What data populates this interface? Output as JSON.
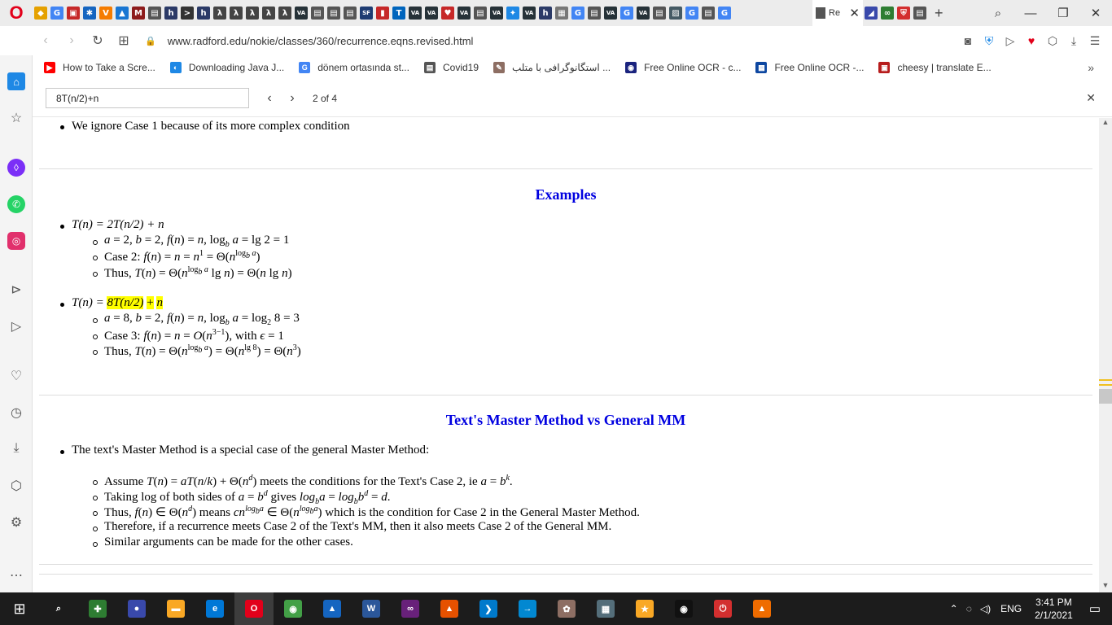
{
  "browser": {
    "active_tab_title": "Re",
    "url": "www.radford.edu/nokie/classes/360/recurrence.eqns.revised.html",
    "tab_icons": [
      {
        "icon": "opera-gx-icon",
        "color": "#e5a100",
        "label": "◆"
      },
      {
        "icon": "google-icon",
        "color": "#4285f4",
        "label": "G"
      },
      {
        "icon": "app-icon",
        "color": "#c62828",
        "label": "▣"
      },
      {
        "icon": "settings-icon",
        "color": "#1565c0",
        "label": "✱"
      },
      {
        "icon": "v-icon",
        "color": "#f57c00",
        "label": "V"
      },
      {
        "icon": "drive-icon",
        "color": "#1976d2",
        "label": "▲"
      },
      {
        "icon": "mit-icon",
        "color": "#8d1b1b",
        "label": "M"
      },
      {
        "icon": "document-icon",
        "color": "#555555",
        "label": "▤"
      },
      {
        "icon": "h-icon",
        "color": "#2b3a67",
        "label": "h"
      },
      {
        "icon": "terminal-icon",
        "color": "#333333",
        "label": ">"
      },
      {
        "icon": "h-icon",
        "color": "#2b3a67",
        "label": "h"
      },
      {
        "icon": "lambda-icon",
        "color": "#444444",
        "label": "λ"
      },
      {
        "icon": "lambda-icon",
        "color": "#444444",
        "label": "λ"
      },
      {
        "icon": "lambda-icon",
        "color": "#444444",
        "label": "λ"
      },
      {
        "icon": "lambda-icon",
        "color": "#444444",
        "label": "λ"
      },
      {
        "icon": "lambda-icon",
        "color": "#444444",
        "label": "λ"
      },
      {
        "icon": "va-icon",
        "color": "#263238",
        "label": "VA"
      },
      {
        "icon": "document-icon",
        "color": "#555555",
        "label": "▤"
      },
      {
        "icon": "document-icon",
        "color": "#555555",
        "label": "▤"
      },
      {
        "icon": "document-icon",
        "color": "#555555",
        "label": "▤"
      },
      {
        "icon": "sf-icon",
        "color": "#1e3c72",
        "label": "SF"
      },
      {
        "icon": "bar-chart-icon",
        "color": "#c62828",
        "label": "▮"
      },
      {
        "icon": "tum-icon",
        "color": "#0065bd",
        "label": "T"
      },
      {
        "icon": "va-icon",
        "color": "#263238",
        "label": "VA"
      },
      {
        "icon": "va-icon",
        "color": "#263238",
        "label": "VA"
      },
      {
        "icon": "heart-icon",
        "color": "#c62828",
        "label": "♥"
      },
      {
        "icon": "va-icon",
        "color": "#263238",
        "label": "VA"
      },
      {
        "icon": "document-icon",
        "color": "#555555",
        "label": "▤"
      },
      {
        "icon": "va-icon",
        "color": "#263238",
        "label": "VA"
      },
      {
        "icon": "star-icon",
        "color": "#1e88e5",
        "label": "✦"
      },
      {
        "icon": "va-icon",
        "color": "#263238",
        "label": "VA"
      },
      {
        "icon": "h-icon",
        "color": "#2b3a67",
        "label": "h"
      },
      {
        "icon": "grid-icon",
        "color": "#777777",
        "label": "▦"
      },
      {
        "icon": "google-icon",
        "color": "#4285f4",
        "label": "G"
      },
      {
        "icon": "document-icon",
        "color": "#555555",
        "label": "▤"
      },
      {
        "icon": "va-icon",
        "color": "#263238",
        "label": "VA"
      },
      {
        "icon": "google-icon",
        "color": "#4285f4",
        "label": "G"
      },
      {
        "icon": "va-icon",
        "color": "#263238",
        "label": "VA"
      },
      {
        "icon": "document-icon",
        "color": "#555555",
        "label": "▤"
      },
      {
        "icon": "image-icon",
        "color": "#455a64",
        "label": "▨"
      },
      {
        "icon": "google-icon",
        "color": "#4285f4",
        "label": "G"
      },
      {
        "icon": "document-icon",
        "color": "#555555",
        "label": "▤"
      },
      {
        "icon": "google-icon",
        "color": "#4285f4",
        "label": "G"
      }
    ],
    "bookmarks": [
      {
        "label": "How to Take a Scre...",
        "icon": "youtube-icon",
        "color": "#ff0000",
        "glyph": "▶"
      },
      {
        "label": "Downloading Java J...",
        "icon": "java-icon",
        "color": "#1e88e5",
        "glyph": "◐"
      },
      {
        "label": "dönem ortasında st...",
        "icon": "google-icon",
        "color": "#4285f4",
        "glyph": "G"
      },
      {
        "label": "Covid19",
        "icon": "document-icon",
        "color": "#555555",
        "glyph": "▤"
      },
      {
        "label": "استگانوگرافی با متلب ...",
        "icon": "steg-icon",
        "color": "#8d6e63",
        "glyph": "✎"
      },
      {
        "label": "Free Online OCR - c...",
        "icon": "ocr-icon",
        "color": "#1a237e",
        "glyph": "◉"
      },
      {
        "label": "Free Online OCR -...",
        "icon": "ocr-grid-icon",
        "color": "#0d47a1",
        "glyph": "▦"
      },
      {
        "label": "cheesy | translate E...",
        "icon": "cambridge-icon",
        "color": "#b71c1c",
        "glyph": "▣"
      }
    ]
  },
  "findbar": {
    "query": "8T(n/2)+n",
    "count": "2 of 4"
  },
  "content": {
    "ignore_case_item": "We ignore Case 1 because of its more complex condition",
    "examples_heading": "Examples",
    "example1": {
      "head": "T(n) = 2T(n/2) + n",
      "items": [
        "a = 2, b = 2, f(n) = n, log_b a = lg 2 = 1",
        "Case 2: f(n) = n = n^1 = Θ(n^(log_b a))",
        "Thus, T(n) = Θ(n^(log_b a) lg n) = Θ(n lg n)"
      ]
    },
    "example2": {
      "head_prefix": "T(n) = ",
      "head_highlight": "8T(n/2)",
      "head_plus": "+",
      "head_n": "n",
      "items": [
        "a = 8, b = 2, f(n) = n, log_b a = log_2 8 = 3",
        "Case 3: f(n) = n = O(n^(3−1)), with ϵ = 1",
        "Thus, T(n) = Θ(n^(log_b a)) = Θ(n^(lg 8)) = Θ(n^3)"
      ]
    },
    "text_mm_heading": "Text's Master Method vs General MM",
    "text_mm_intro": "The text's Master Method is a special case of the general Master Method:",
    "text_mm_items": [
      "Assume T(n) = aT(n/k) + Θ(n^d) meets the conditions for the Text's Case 2, ie a = b^k.",
      "Taking log of both sides of a = b^d gives log_b a = log_b b^d = d.",
      "Thus, f(n) ∈ Θ(n^d) means cn^(log_b a) ∈ Θ(n^(log_b a)) which is the condition for Case 2 in the General Master Method.",
      "Therefore, if a recurrence meets Case 2 of the Text's MM, then it also meets Case 2 of the General MM.",
      "Similar arguments can be made for the other cases."
    ]
  },
  "taskbar": {
    "apps": [
      {
        "name": "search",
        "glyph": "⌕",
        "color": "#1c1c1c"
      },
      {
        "name": "cheat-engine",
        "glyph": "✚",
        "color": "#2e7d32"
      },
      {
        "name": "eclipse",
        "glyph": "●",
        "color": "#3949ab"
      },
      {
        "name": "file-explorer",
        "glyph": "▬",
        "color": "#f9a825"
      },
      {
        "name": "edge",
        "glyph": "e",
        "color": "#0078d7"
      },
      {
        "name": "opera",
        "glyph": "O",
        "color": "#e2001a"
      },
      {
        "name": "chrome",
        "glyph": "◉",
        "color": "#43a047"
      },
      {
        "name": "photos",
        "glyph": "▲",
        "color": "#1565c0"
      },
      {
        "name": "word",
        "glyph": "W",
        "color": "#2b579a"
      },
      {
        "name": "visual-studio",
        "glyph": "∞",
        "color": "#68217a"
      },
      {
        "name": "matlab",
        "glyph": "▲",
        "color": "#e65100"
      },
      {
        "name": "vscode",
        "glyph": "❯",
        "color": "#007acc"
      },
      {
        "name": "remote-desktop",
        "glyph": "→",
        "color": "#0288d1"
      },
      {
        "name": "paint",
        "glyph": "✿",
        "color": "#8d6e63"
      },
      {
        "name": "calculator",
        "glyph": "▦",
        "color": "#546e7a"
      },
      {
        "name": "star-app",
        "glyph": "★",
        "color": "#f9a825"
      },
      {
        "name": "obs",
        "glyph": "◉",
        "color": "#111111"
      },
      {
        "name": "power-app",
        "glyph": "⏻",
        "color": "#d32f2f"
      },
      {
        "name": "vlc",
        "glyph": "▲",
        "color": "#ef6c00"
      }
    ],
    "language": "ENG",
    "time": "3:41 PM",
    "date": "2/1/2021"
  }
}
